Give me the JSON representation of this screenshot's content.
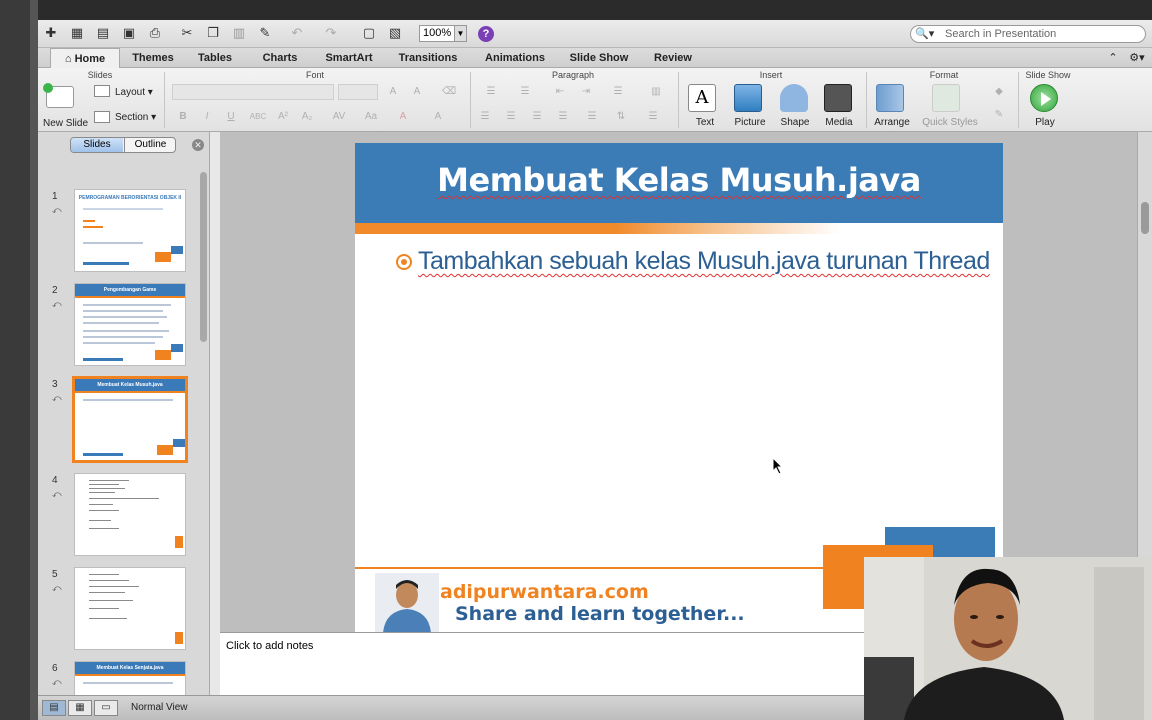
{
  "toolbar": {
    "zoom_value": "100%",
    "search_placeholder": "Search in Presentation"
  },
  "tabs": [
    "Home",
    "Themes",
    "Tables",
    "Charts",
    "SmartArt",
    "Transitions",
    "Animations",
    "Slide Show",
    "Review"
  ],
  "ribbon": {
    "groups": {
      "slides": "Slides",
      "font": "Font",
      "paragraph": "Paragraph",
      "insert": "Insert",
      "format": "Format",
      "slide_show": "Slide Show"
    },
    "new_slide": "New Slide",
    "layout": "Layout",
    "section": "Section",
    "insert_buttons": [
      "Text",
      "Picture",
      "Shape",
      "Media"
    ],
    "arrange": "Arrange",
    "quick_styles": "Quick Styles",
    "play": "Play"
  },
  "pane": {
    "slides_tab": "Slides",
    "outline_tab": "Outline",
    "thumbnails": [
      {
        "num": "1",
        "title": "PEMROGRAMAN BERORIENTASI OBJEK II"
      },
      {
        "num": "2",
        "title": "Pengembangan Game"
      },
      {
        "num": "3",
        "title": "Membuat Kelas Musuh.java"
      },
      {
        "num": "4",
        "title": ""
      },
      {
        "num": "5",
        "title": ""
      },
      {
        "num": "6",
        "title": "Membuat Kelas Senjata.java"
      }
    ]
  },
  "slide": {
    "title": "Membuat Kelas Musuh.java",
    "bullet": "Tambahkan sebuah kelas Musuh.java turunan Thread",
    "footer_site": "adipurwantara.com",
    "footer_tagline": "Share and learn together..."
  },
  "notes_placeholder": "Click to add notes",
  "status": {
    "mode": "Normal View"
  }
}
